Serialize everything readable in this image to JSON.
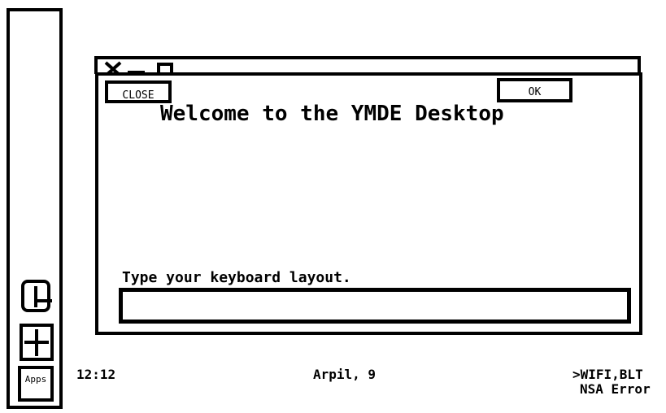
{
  "dock": {
    "items": [
      {
        "icon": "clock-icon"
      },
      {
        "icon": "plus-icon"
      },
      {
        "label": "Apps"
      }
    ]
  },
  "window": {
    "titlebar_icons": [
      "close-x-icon",
      "minimize-icon",
      "maximize-icon"
    ],
    "close_label": "CLOSE",
    "ok_label": "OK",
    "heading": "Welcome to the YMDE Desktop",
    "prompt": "Type your keyboard layout.",
    "input_value": "",
    "input_placeholder": ""
  },
  "statusbar": {
    "time": "12:12",
    "date": "Arpil, 9",
    "network": ">WIFI,BLT",
    "error": "NSA Error"
  },
  "colors": {
    "foreground": "#000000",
    "background": "#ffffff"
  }
}
